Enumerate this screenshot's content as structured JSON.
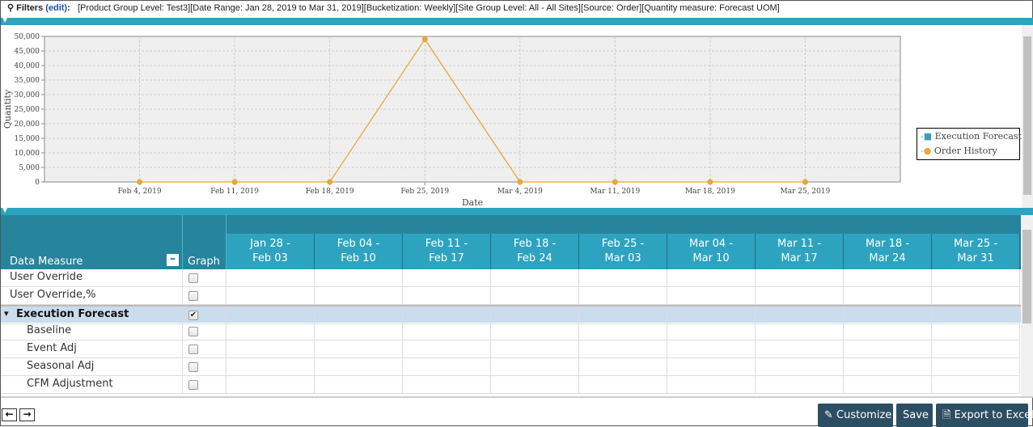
{
  "filters": {
    "label": "Filters",
    "edit": "(edit)",
    "colon": ":",
    "text": "[Product Group Level: Test3][Date Range: Jan 28, 2019 to Mar 31, 2019][Bucketization: Weekly][Site Group Level: All - All Sites][Source: Order][Quantity measure: Forecast UOM]"
  },
  "chart_data": {
    "type": "line",
    "xlabel": "Date",
    "ylabel": "Quantity",
    "ylim": [
      0,
      50000
    ],
    "yticks": [
      "0",
      "5,000",
      "10,000",
      "15,000",
      "20,000",
      "25,000",
      "30,000",
      "35,000",
      "40,000",
      "45,000",
      "50,000"
    ],
    "categories": [
      "Feb 4, 2019",
      "Feb 11, 2019",
      "Feb 18, 2019",
      "Feb 25, 2019",
      "Mar 4, 2019",
      "Mar 11, 2019",
      "Mar 18, 2019",
      "Mar 25, 2019"
    ],
    "series": [
      {
        "name": "Execution Forecast",
        "color": "#3a9fb8",
        "values": []
      },
      {
        "name": "Order History",
        "color": "#e8a838",
        "values": [
          0,
          0,
          0,
          49000,
          0,
          0,
          0,
          0
        ]
      }
    ],
    "legend": "right"
  },
  "table": {
    "col_data_measure": "Data Measure",
    "col_graph": "Graph",
    "periods": [
      [
        "Jan 28 -",
        "Feb 03"
      ],
      [
        "Feb 04 -",
        "Feb 10"
      ],
      [
        "Feb 11 -",
        "Feb 17"
      ],
      [
        "Feb 18 -",
        "Feb 24"
      ],
      [
        "Feb 25 -",
        "Mar 03"
      ],
      [
        "Mar 04 -",
        "Mar 10"
      ],
      [
        "Mar 11 -",
        "Mar 17"
      ],
      [
        "Mar 18 -",
        "Mar 24"
      ],
      [
        "Mar 25 -",
        "Mar 31"
      ]
    ],
    "rows": [
      {
        "label": "User Override",
        "checked": false,
        "level": 0
      },
      {
        "label": "User Override,%",
        "checked": false,
        "level": 0
      },
      {
        "label": "Execution Forecast",
        "checked": true,
        "level": -1,
        "group": true
      },
      {
        "label": "Baseline",
        "checked": false,
        "level": 1
      },
      {
        "label": "Event Adj",
        "checked": false,
        "level": 1
      },
      {
        "label": "Seasonal Adj",
        "checked": false,
        "level": 1
      },
      {
        "label": "CFM Adjustment",
        "checked": false,
        "level": 1
      }
    ]
  },
  "buttons": {
    "customize": "Customize",
    "save": "Save",
    "export": "Export to Excel"
  }
}
